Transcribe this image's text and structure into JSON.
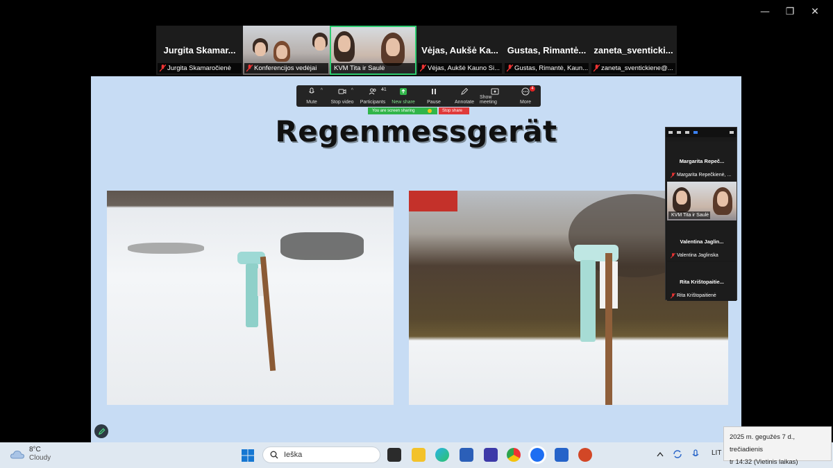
{
  "window_controls": {
    "minimize": "—",
    "restore": "❐",
    "close": "✕"
  },
  "strip": [
    {
      "big_name": "Jurgita  Skamar...",
      "label": "Jurgita Skamaročienė",
      "video": false
    },
    {
      "big_name": "",
      "label": "Konferencijos vedėjai",
      "video": true
    },
    {
      "big_name": "",
      "label": "KVM Tita ir Saulė",
      "video": true
    },
    {
      "big_name": "Vėjas,  Aukšė  Ka...",
      "label": "Vėjas, Aukšė Kauno Si...",
      "video": false
    },
    {
      "big_name": "Gustas,  Rimantė...",
      "label": "Gustas, Rimantė, Kaun...",
      "video": false
    },
    {
      "big_name": "zaneta_sventicki...",
      "label": "zaneta_sventickiene@...",
      "video": false
    }
  ],
  "toolbar": {
    "mute": "Mute",
    "stop_video": "Stop video",
    "participants": "Participants",
    "participants_count": "41",
    "new_share": "New share",
    "pause": "Pause",
    "annotate": "Annotate",
    "show_meeting": "Show meeting",
    "more": "More",
    "more_badge": "4"
  },
  "share_banner": {
    "sharing": "You are screen sharing",
    "stop": "Stop share"
  },
  "slide": {
    "title": "Regenmessgerät"
  },
  "panel": [
    {
      "name": "Margarita  Repeč...",
      "label": "Margarita Repečkienė, ...",
      "video": false
    },
    {
      "name": "",
      "label": "KVM Tita ir Saulė",
      "video": true
    },
    {
      "name": "Valentina  Jaglin...",
      "label": "Valentina Jaglinska",
      "video": false
    },
    {
      "name": "Rita  Krištopaitie...",
      "label": "Rita Krištopaitienė",
      "video": false
    }
  ],
  "taskbar": {
    "temperature": "8°C",
    "condition": "Cloudy",
    "search_placeholder": "Ieška",
    "language": "LIT",
    "date_partial": "2025-05-07"
  },
  "clock_tooltip": {
    "line1": "2025 m. gegužės 7 d., trečiadienis",
    "line2": "tr 14:32 (Vietinis laikas)"
  },
  "colors": {
    "accent_green": "#2ecc71",
    "slide_bg": "#c7dcf4",
    "taskbar_bg": "#dfe8f1",
    "stop_red": "#e03a3a"
  }
}
